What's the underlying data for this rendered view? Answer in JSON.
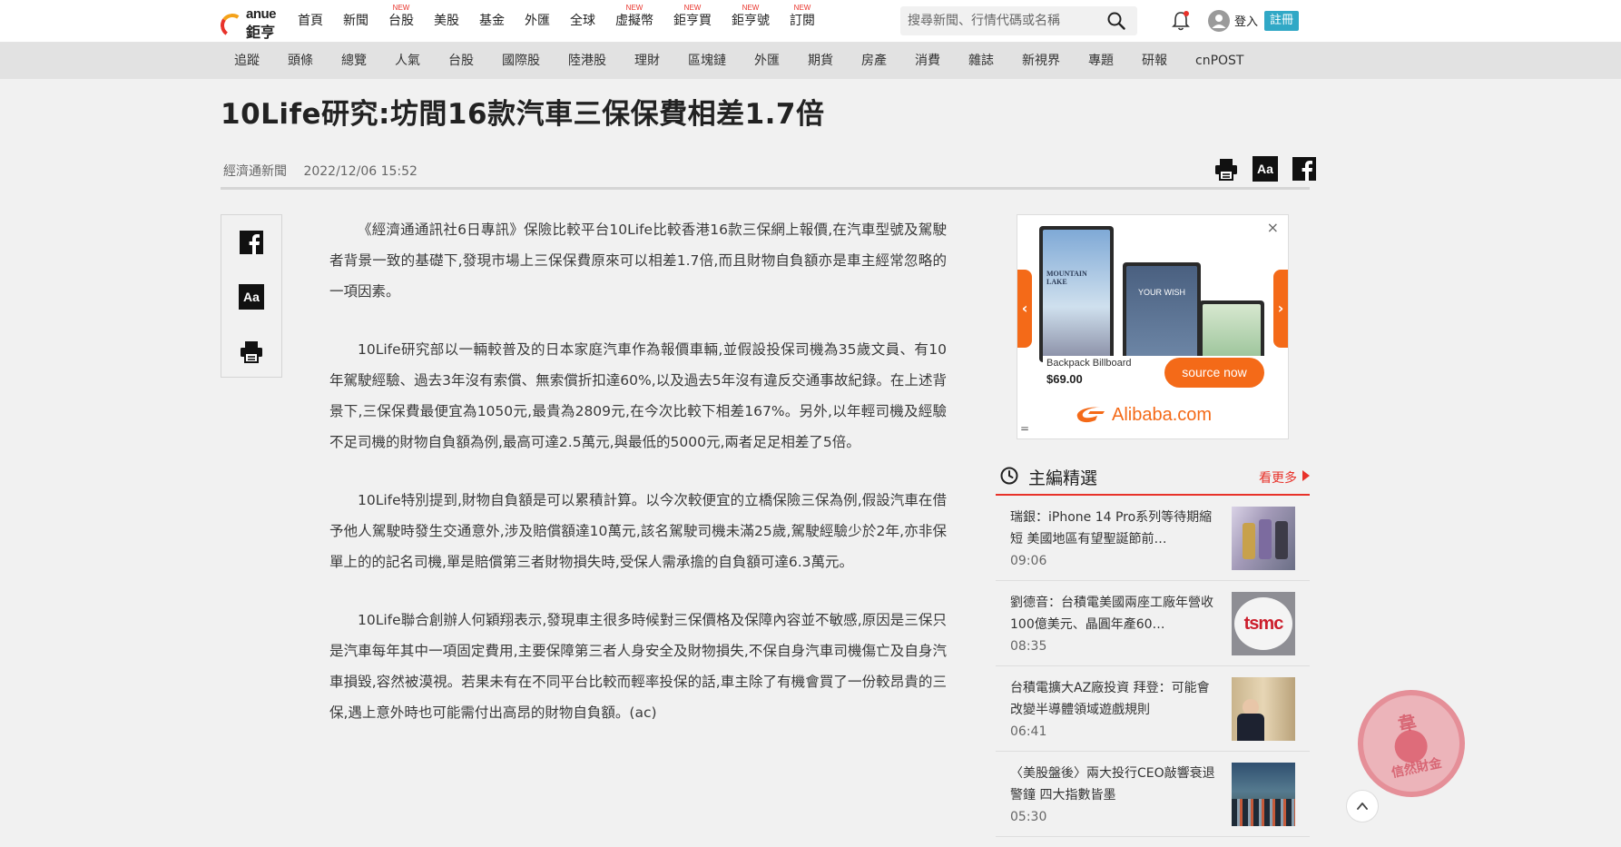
{
  "brand": {
    "logo_en": "anue",
    "logo_zh": "鉅亨"
  },
  "nav": {
    "items": [
      {
        "label": "首頁",
        "badge": ""
      },
      {
        "label": "新聞",
        "badge": ""
      },
      {
        "label": "台股",
        "badge": "NEW"
      },
      {
        "label": "美股",
        "badge": ""
      },
      {
        "label": "基金",
        "badge": ""
      },
      {
        "label": "外匯",
        "badge": ""
      },
      {
        "label": "全球",
        "badge": ""
      },
      {
        "label": "虛擬幣",
        "badge": "NEW"
      },
      {
        "label": "鉅亨買",
        "badge": "NEW"
      },
      {
        "label": "鉅亨號",
        "badge": "NEW"
      },
      {
        "label": "訂閱",
        "badge": "NEW"
      }
    ],
    "search_placeholder": "搜尋新聞、行情代碼或名稱",
    "login_label": "登入",
    "register_label": "註冊"
  },
  "subnav": {
    "items": [
      "追蹤",
      "頭條",
      "總覽",
      "人氣",
      "台股",
      "國際股",
      "陸港股",
      "理財",
      "區塊鏈",
      "外匯",
      "期貨",
      "房產",
      "消費",
      "雜誌",
      "新視界",
      "專題",
      "研報",
      "cnPOST"
    ]
  },
  "article": {
    "title": "10Life研究:坊間16款汽車三保保費相差1.7倍",
    "source": "經濟通新聞",
    "datetime": "2022/12/06 15:52",
    "tools": {
      "aa_label": "Aa"
    },
    "paragraphs": [
      "《經濟通通訊社6日專訊》保險比較平台10Life比較香港16款三保網上報價,在汽車型號及駕駛者背景一致的基礎下,發現市場上三保保費原來可以相差1.7倍,而且財物自負額亦是車主經常忽略的一項因素。",
      "10Life研究部以一輛較普及的日本家庭汽車作為報價車輛,並假設投保司機為35歲文員、有10年駕駛經驗、過去3年沒有索償、無索償折扣達60%,以及過去5年沒有違反交通事故紀錄。在上述背景下,三保保費最便宜為1050元,最貴為2809元,在今次比較下相差167%。另外,以年輕司機及經驗不足司機的財物自負額為例,最高可達2.5萬元,與最低的5000元,兩者足足相差了5倍。",
      "10Life特別提到,財物自負額是可以累積計算。以今次較便宜的立橋保險三保為例,假設汽車在借予他人駕駛時發生交通意外,涉及賠償額達10萬元,該名駕駛司機未滿25歲,駕駛經驗少於2年,亦非保單上的的記名司機,單是賠償第三者財物損失時,受保人需承擔的自負額可達6.3萬元。",
      "10Life聯合創辦人何穎翔表示,發現車主很多時候對三保價格及保障內容並不敏感,原因是三保只是汽車每年其中一項固定費用,主要保障第三者人身安全及財物損失,不保自身汽車司機傷亡及自身汽車損毀,容然被漠視。若果未有在不同平台比較而輕率投保的話,車主除了有機會買了一份較昂貴的三保,遇上意外時也可能需付出高昂的財物自負額。(ac)"
    ]
  },
  "ad": {
    "close_label": "×",
    "screens": [
      "MOUNTAIN LAKE",
      "YOUR WISH"
    ],
    "product": "Backpack Billboard",
    "price": "$69.00",
    "cta": "source now",
    "brand": "Alibaba.com",
    "menu_glyph": "="
  },
  "picks": {
    "title": "主編精選",
    "more_label": "看更多",
    "items": [
      {
        "title": "瑞銀：iPhone 14 Pro系列等待期縮短 美國地區有望聖誕節前…",
        "time": "09:06"
      },
      {
        "title": "劉德音：台積電美國兩座工廠年營收100億美元、晶圓年產60…",
        "time": "08:35"
      },
      {
        "title": "台積電擴大AZ廠投資 拜登：可能會改變半導體領域遊戲規則",
        "time": "06:41"
      },
      {
        "title": "〈美股盤後〉兩大投行CEO敲響衰退警鐘 四大指數皆墨",
        "time": "05:30"
      }
    ]
  },
  "watermark": {
    "text_top": "韋",
    "text_bottom": "信然財金"
  },
  "colors": {
    "accent": "#e8322a",
    "register": "#31a8c6",
    "alibaba": "#f46a18"
  }
}
